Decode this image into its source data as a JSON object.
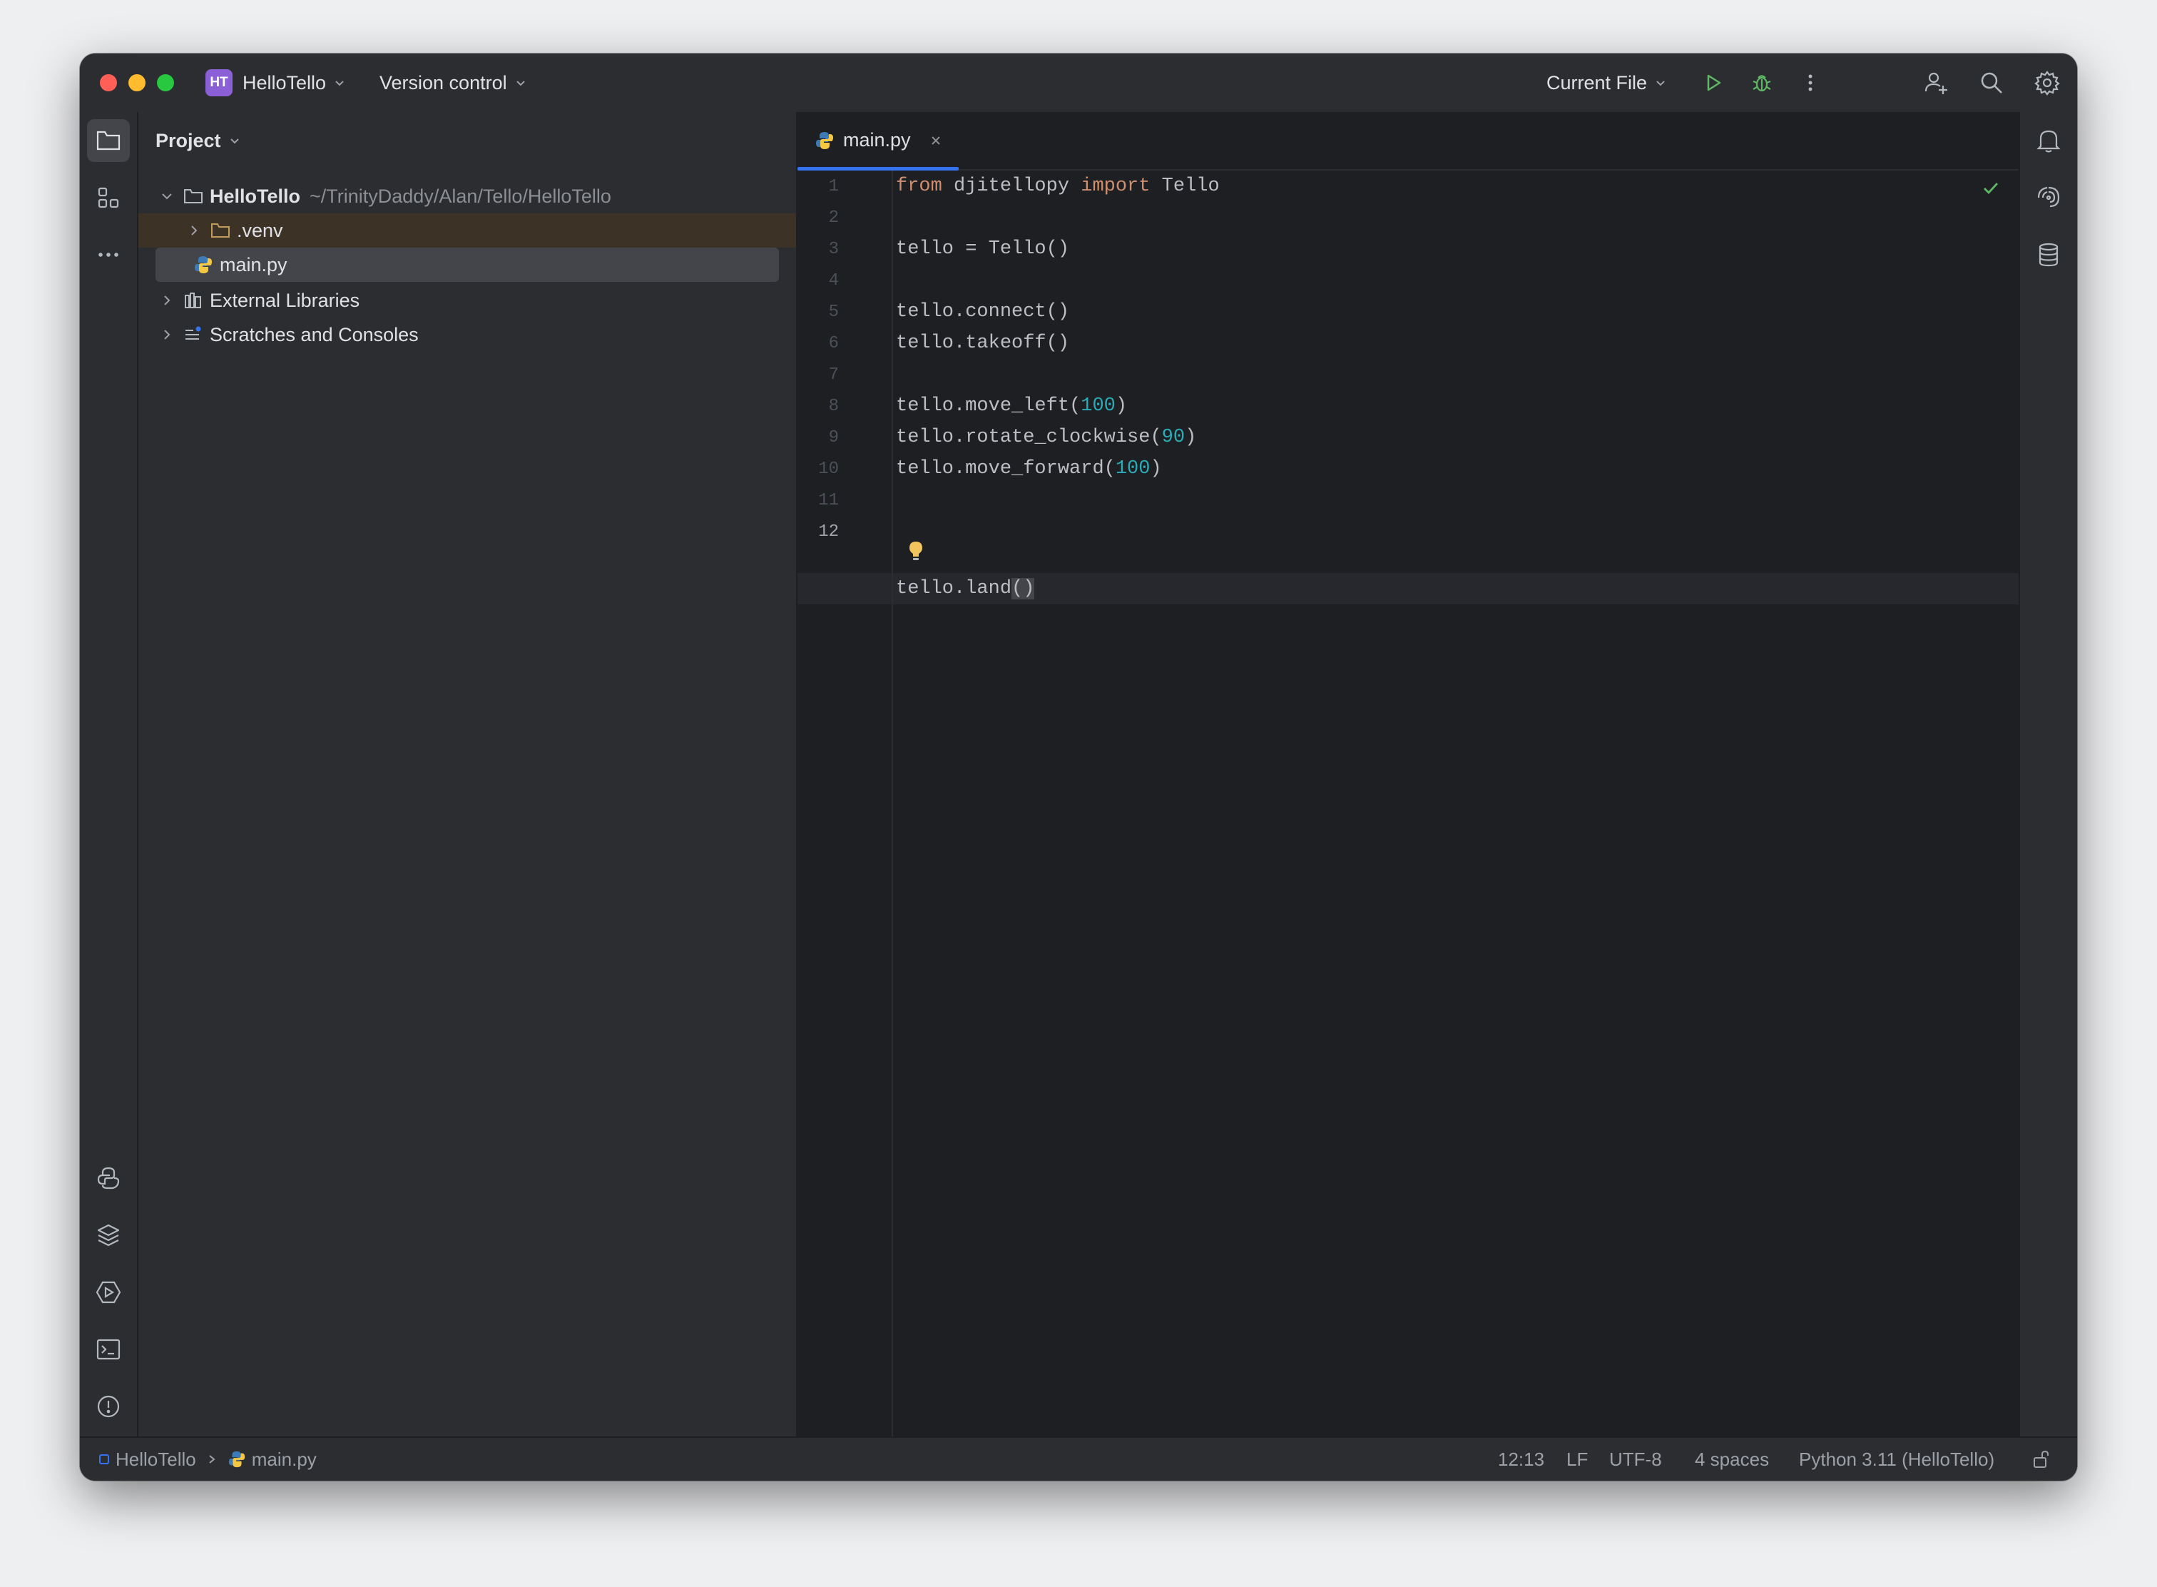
{
  "titlebar": {
    "project_initials": "HT",
    "project_name": "HelloTello",
    "vcs_label": "Version control",
    "run_config": "Current File"
  },
  "project_panel": {
    "title": "Project",
    "root": {
      "name": "HelloTello",
      "path": "~/TrinityDaddy/Alan/Tello/HelloTello"
    },
    "items": [
      {
        "label": ".venv"
      },
      {
        "label": "main.py"
      },
      {
        "label": "External Libraries"
      },
      {
        "label": "Scratches and Consoles"
      }
    ]
  },
  "editor": {
    "tab": {
      "label": "main.py"
    },
    "line_numbers": [
      "1",
      "2",
      "3",
      "4",
      "5",
      "6",
      "7",
      "8",
      "9",
      "10",
      "11",
      "12"
    ],
    "code": {
      "l1_kw1": "from",
      "l1_mod": " djitellopy ",
      "l1_kw2": "import",
      "l1_name": " Tello",
      "l3": "tello = Tello()",
      "l5": "tello.connect()",
      "l6": "tello.takeoff()",
      "l8_pre": "tello.move_left(",
      "l8_num": "100",
      "l8_post": ")",
      "l9_pre": "tello.rotate_clockwise(",
      "l9_num": "90",
      "l9_post": ")",
      "l10_pre": "tello.move_forward(",
      "l10_num": "100",
      "l10_post": ")",
      "l12_pre": "tello.land",
      "l12_paren": "()"
    }
  },
  "statusbar": {
    "breadcrumb_project": "HelloTello",
    "breadcrumb_file": "main.py",
    "position": "12:13",
    "line_ending": "LF",
    "encoding": "UTF-8",
    "indent": "4 spaces",
    "interpreter": "Python 3.11 (HelloTello)"
  },
  "colors": {
    "keyword": "#cf8e6d",
    "number": "#2aacb8",
    "accent": "#3574f0",
    "run_green": "#5fb865"
  },
  "icons": [
    "folder-icon",
    "structure-icon",
    "more-icon",
    "python-console-icon",
    "layers-icon",
    "services-icon",
    "terminal-icon",
    "problems-icon",
    "git-icon",
    "bell-icon",
    "ai-assistant-icon",
    "database-icon",
    "run-icon",
    "debug-icon",
    "search-icon",
    "settings-icon",
    "add-user-icon",
    "lock-icon"
  ]
}
